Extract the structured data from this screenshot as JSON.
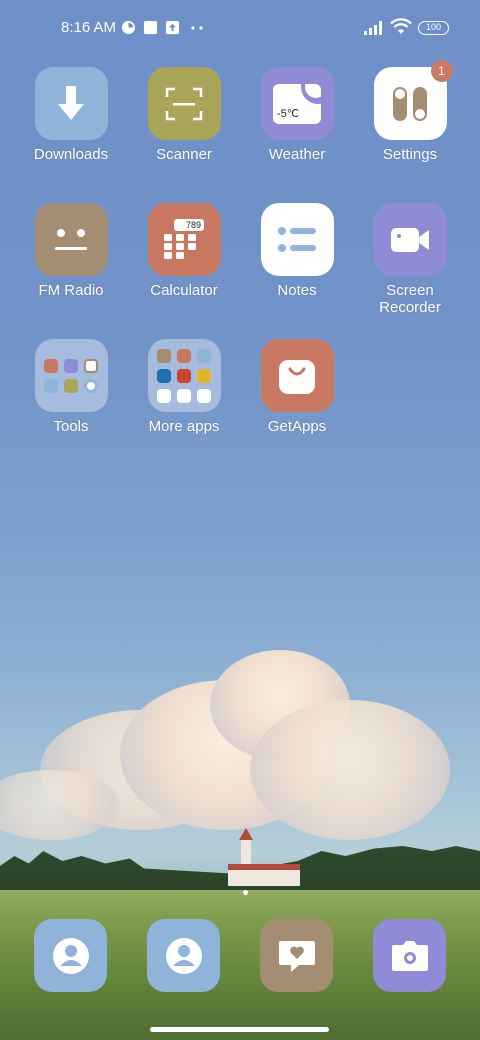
{
  "status_bar": {
    "time": "8:16 AM",
    "battery": "100",
    "icons": [
      "data-saver-icon",
      "notification-square-icon",
      "upload-icon",
      "more-dots-icon",
      "signal-icon",
      "wifi-icon",
      "battery-icon"
    ]
  },
  "apps": [
    {
      "label": "Downloads",
      "icon": "download-icon",
      "color": "#8fb3d9"
    },
    {
      "label": "Scanner",
      "icon": "scan-icon",
      "color": "#a9a65a"
    },
    {
      "label": "Weather",
      "icon": "weather-icon",
      "color": "#8f8bd6",
      "value": "-5℃"
    },
    {
      "label": "Settings",
      "icon": "settings-toggle-icon",
      "color": "#ffffff",
      "badge": "1"
    },
    {
      "label": "FM Radio",
      "icon": "radio-face-icon",
      "color": "#a58d73"
    },
    {
      "label": "Calculator",
      "icon": "calculator-icon",
      "color": "#c87760",
      "value": "789"
    },
    {
      "label": "Notes",
      "icon": "notes-list-icon",
      "color": "#ffffff"
    },
    {
      "label": "Screen\nRecorder",
      "icon": "video-camera-icon",
      "color": "#8f8bd6"
    },
    {
      "label": "Tools",
      "icon": "folder-icon",
      "color": "#c6d6ee"
    },
    {
      "label": "More apps",
      "icon": "folder-icon",
      "color": "#c6d6ee"
    },
    {
      "label": "GetApps",
      "icon": "shopping-bag-icon",
      "color": "#c87760"
    }
  ],
  "folders": {
    "tools": [
      "#c87760",
      "#8f8bd6",
      "#a58d73",
      "#8fb3d9",
      "#a9a65a",
      "#8fb3d9"
    ],
    "more_apps": [
      "#a58d73",
      "#c87760",
      "#8fb3d9",
      "#1f6fb2",
      "#c9432f",
      "#e3b42b",
      "#ffffff",
      "#ffffff",
      "#ffffff"
    ]
  },
  "dock": [
    {
      "icon": "contacts-icon",
      "color": "#8fb3d9"
    },
    {
      "icon": "contacts-icon",
      "color": "#8fb3d9"
    },
    {
      "icon": "messaging-heart-icon",
      "color": "#a58d73"
    },
    {
      "icon": "camera-icon",
      "color": "#8f8bd6"
    }
  ],
  "page_indicator": {
    "current": 1,
    "total": 1
  }
}
